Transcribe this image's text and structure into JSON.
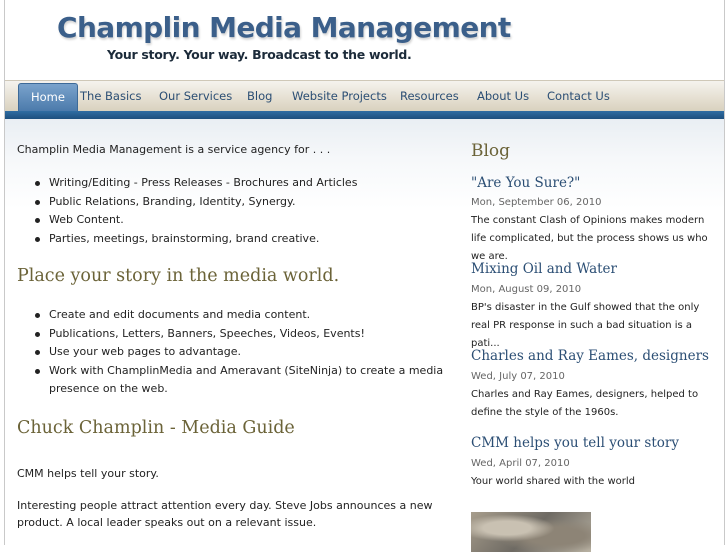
{
  "header": {
    "title": "Champlin Media Management",
    "tagline": "Your story.  Your way.   Broadcast to the world."
  },
  "nav": {
    "items": [
      "Home",
      "The Basics",
      "Our Services",
      "Blog",
      "Website Projects",
      "Resources",
      "About Us",
      "Contact Us"
    ],
    "active": "Home"
  },
  "main": {
    "intro": "Champlin Media Management is a service agency for . . .",
    "list1": [
      "Writing/Editing  -  Press Releases  -  Brochures and Articles",
      "Public Relations, Branding, Identity, Synergy.",
      "Web Content.",
      "Parties, meetings, brainstorming, brand creative."
    ],
    "heading1": "Place your story in the media world.",
    "list2": [
      "Create and edit documents and media content.",
      "Publications, Letters, Banners, Speeches, Videos, Events!",
      "Use your web pages to advantage.",
      "Work with ChamplinMedia and Ameravant (SiteNinja) to create a media presence on the web."
    ],
    "heading2": "Chuck Champlin - Media Guide",
    "para1": "CMM helps tell your story.",
    "para2": "Interesting people attract attention every day.  Steve Jobs announces a new product.  A local leader speaks out on a relevant issue."
  },
  "sidebar": {
    "title": "Blog",
    "posts": [
      {
        "title": "\"Are You Sure?\"",
        "date": "Mon, September 06, 2010",
        "excerpt": "The constant Clash of Opinions makes modern life complicated, but the process shows us who we are."
      },
      {
        "title": "Mixing Oil and Water",
        "date": "Mon, August 09, 2010",
        "excerpt": "BP's disaster in the Gulf showed that the only real PR response in such a bad situation is a pati..."
      },
      {
        "title": "Charles and Ray Eames, designers",
        "date": "Wed, July 07, 2010",
        "excerpt": "Charles and Ray Eames, designers, helped to define the style of the 1960s."
      },
      {
        "title": "CMM helps you tell your story",
        "date": "Wed, April 07, 2010",
        "excerpt": "Your world shared with the world"
      }
    ]
  },
  "colors": {
    "title_blue": "#3b5f8a",
    "nav_text": "#2b4e74",
    "heading_olive": "#6b6338",
    "band_blue": "#2f6da3"
  }
}
